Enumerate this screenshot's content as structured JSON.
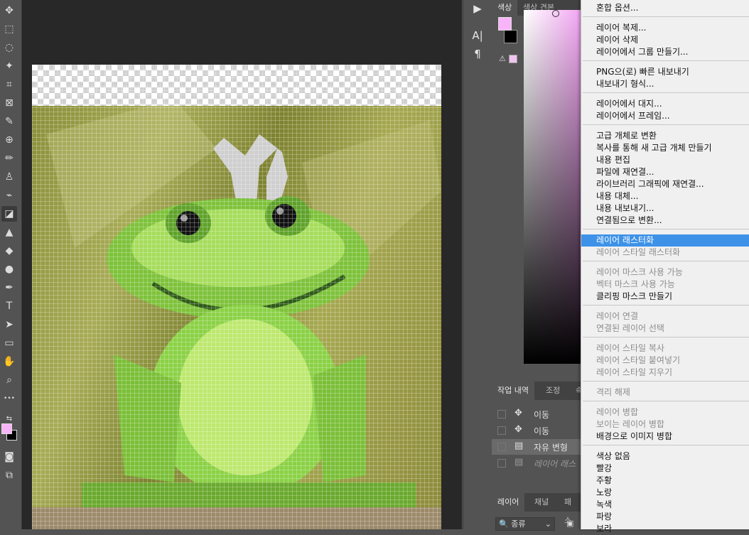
{
  "toolbar": {
    "tools": [
      "move-tool",
      "marquee-tool",
      "lasso-tool",
      "magic-wand-tool",
      "crop-tool",
      "frame-tool",
      "eyedropper-tool",
      "healing-brush-tool",
      "brush-tool",
      "clone-stamp-tool",
      "history-brush-tool",
      "eraser-tool",
      "paint-bucket-tool",
      "sharpen-tool",
      "dodge-tool",
      "pen-tool",
      "type-tool",
      "path-selection-tool",
      "rectangle-tool",
      "hand-tool",
      "zoom-tool",
      "more-tools"
    ],
    "text_tool_label": "T",
    "more_label": "•••",
    "foreground_color": "#f9b3f9",
    "background_color": "#000000"
  },
  "narrow_strip": {
    "play_icon": "▶",
    "character_icon": "A|",
    "paragraph_icon": "¶"
  },
  "color_panel": {
    "tabs": [
      "색상",
      "색상 견본"
    ],
    "foreground_color": "#f9b3f9",
    "background_color": "#000000"
  },
  "history_panel": {
    "tabs": [
      "작업 내역",
      "조정",
      "속"
    ],
    "rows": [
      {
        "label": "이동",
        "icon": "move-icon"
      },
      {
        "label": "이동",
        "icon": "move-icon"
      },
      {
        "label": "자유 변형",
        "icon": "document-icon"
      },
      {
        "label": "레이어 래스",
        "icon": "document-icon"
      }
    ]
  },
  "layers_panel": {
    "tabs": [
      "레이어",
      "채널",
      "패스"
    ],
    "filter_label": "종류"
  },
  "context_menu": {
    "groups": [
      [
        {
          "label": "혼합 옵션...",
          "enabled": true
        }
      ],
      [
        {
          "label": "레이어 복제...",
          "enabled": true
        },
        {
          "label": "레이어 삭제",
          "enabled": true
        },
        {
          "label": "레이어에서 그룹 만들기...",
          "enabled": true
        }
      ],
      [
        {
          "label": "PNG으(로) 빠른 내보내기",
          "enabled": true
        },
        {
          "label": "내보내기 형식...",
          "enabled": true
        }
      ],
      [
        {
          "label": "레이어에서 대지...",
          "enabled": true
        },
        {
          "label": "레이어에서 프레임...",
          "enabled": true
        }
      ],
      [
        {
          "label": "고급 개체로 변환",
          "enabled": true
        },
        {
          "label": "복사를 통해 새 고급 개체 만들기",
          "enabled": true
        },
        {
          "label": "내용 편집",
          "enabled": true
        },
        {
          "label": "파일에 재연결...",
          "enabled": true
        },
        {
          "label": "라이브러리 그래픽에 재연결...",
          "enabled": true
        },
        {
          "label": "내용 대체...",
          "enabled": true
        },
        {
          "label": "내용 내보내기...",
          "enabled": true
        },
        {
          "label": "연결됨으로 변환...",
          "enabled": true
        }
      ],
      [
        {
          "label": "레이어 래스터화",
          "enabled": true,
          "highlighted": true
        },
        {
          "label": "레이어 스타일 래스터화",
          "enabled": false
        }
      ],
      [
        {
          "label": "레이어 마스크 사용 가능",
          "enabled": false
        },
        {
          "label": "벡터 마스크 사용 가능",
          "enabled": false
        },
        {
          "label": "클리핑 마스크 만들기",
          "enabled": true
        }
      ],
      [
        {
          "label": "레이어 연결",
          "enabled": false
        },
        {
          "label": "연결된 레이어 선택",
          "enabled": false
        }
      ],
      [
        {
          "label": "레이어 스타일 복사",
          "enabled": false
        },
        {
          "label": "레이어 스타일 붙여넣기",
          "enabled": false
        },
        {
          "label": "레이어 스타일 지우기",
          "enabled": false
        }
      ],
      [
        {
          "label": "격리 해제",
          "enabled": false
        }
      ],
      [
        {
          "label": "레이어 병합",
          "enabled": false
        },
        {
          "label": "보이는 레이어 병합",
          "enabled": false
        },
        {
          "label": "배경으로 이미지 병합",
          "enabled": true
        }
      ],
      [
        {
          "label": "색상 없음",
          "enabled": true
        },
        {
          "label": "빨강",
          "enabled": true
        },
        {
          "label": "주황",
          "enabled": true
        },
        {
          "label": "노랑",
          "enabled": true
        },
        {
          "label": "녹색",
          "enabled": true
        },
        {
          "label": "파랑",
          "enabled": true
        },
        {
          "label": "보라",
          "enabled": true
        }
      ]
    ]
  }
}
